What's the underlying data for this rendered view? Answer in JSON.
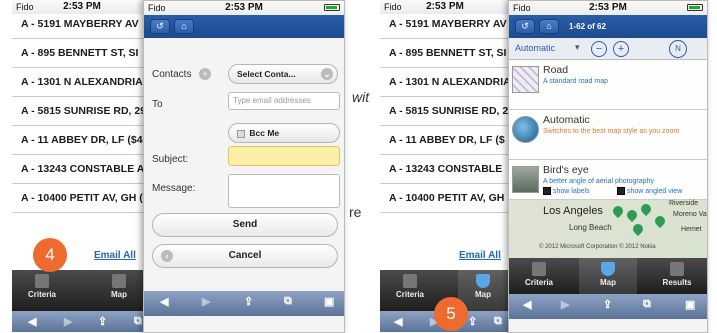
{
  "left_phone": {
    "status": {
      "carrier": "Fido",
      "time": "2:53 PM"
    },
    "rows": [
      "A - 5191 MAYBERRY AV",
      "A - 895 BENNETT ST, SI",
      "A - 1301 N ALEXANDRIA",
      "A - 5815 SUNRISE RD, 29",
      "A - 11 ABBEY DR, LF ($4",
      "A - 13243 CONSTABLE A",
      "A - 10400 PETIT AV, GH ("
    ],
    "email_all": "Email All",
    "toolbar": [
      "Criteria",
      "Map"
    ]
  },
  "email_sheet": {
    "status": {
      "carrier": "Fido",
      "time": "2:53 PM"
    },
    "contacts_label": "Contacts",
    "select_contact": "Select Conta...",
    "to_label": "To",
    "to_placeholder": "Type email addresses",
    "bcc_label": "Bcc Me",
    "subject_label": "Subject:",
    "message_label": "Message:",
    "send": "Send",
    "cancel": "Cancel"
  },
  "fragments": {
    "wit": "wit",
    "re": "re"
  },
  "badges": {
    "left": "4",
    "right": "5"
  },
  "right_phone": {
    "status": {
      "carrier": "Fido",
      "time": "2:53 PM"
    },
    "rows": [
      "A - 5191 MAYBERRY AV",
      "A - 895 BENNETT ST, SI",
      "A - 1301 N ALEXANDRIA",
      "A - 5815 SUNRISE RD, 2",
      "A - 11 ABBEY DR, LF ($",
      "A - 13243 CONSTABLE",
      "A - 10400 PETIT AV, GH"
    ],
    "email_all": "Email All",
    "toolbar": [
      "Criteria",
      "Map"
    ]
  },
  "map_sheet": {
    "status": {
      "carrier": "Fido",
      "time": "2:53 PM"
    },
    "count": "1-62 of 62",
    "mode": "Automatic",
    "options": [
      {
        "title": "Road",
        "sub": "A standard road map"
      },
      {
        "title": "Automatic",
        "sub": "Switches to the best map style as you zoom"
      },
      {
        "title": "Bird's eye",
        "sub": "A better angle of aerial photography"
      }
    ],
    "show_labels": "show labels",
    "show_angled": "show angled view",
    "places": [
      "Los Angeles",
      "Long Beach",
      "Riverside",
      "Moreno Va",
      "Hemet"
    ],
    "copyright": "© 2012 Microsoft Corporation  © 2012 Nokia",
    "toolbar": [
      "Criteria",
      "Map",
      "Results"
    ]
  },
  "colors": {
    "accent_blue": "#1c4b8f",
    "badge_orange": "#ee6a2f",
    "link": "#2466b7"
  }
}
